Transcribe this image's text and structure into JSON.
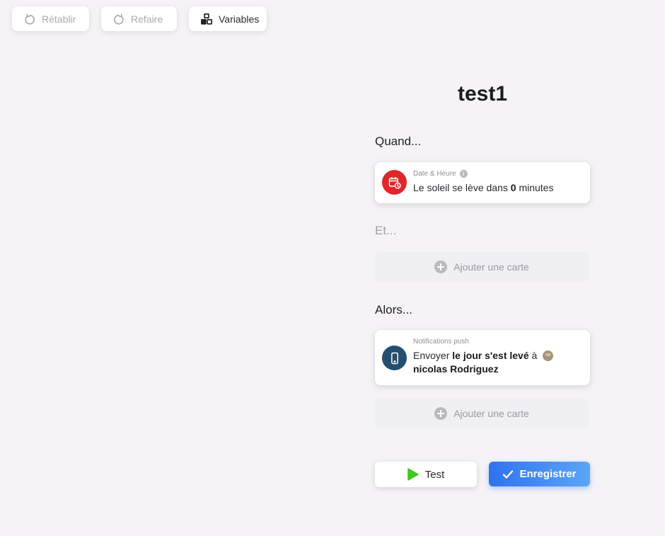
{
  "toolbar": {
    "undo_label": "Rétablir",
    "redo_label": "Refaire",
    "variables_label": "Variables"
  },
  "scenario": {
    "title": "test1"
  },
  "when": {
    "label": "Quand...",
    "card": {
      "category": "Date & Heure",
      "text_before": "Le soleil se lève dans ",
      "value": "0",
      "text_after": " minutes",
      "icon": "calendar-clock-icon",
      "color": "#e2262a"
    }
  },
  "and": {
    "label": "Et...",
    "add_label": "Ajouter une carte"
  },
  "then": {
    "label": "Alors...",
    "card": {
      "category": "Notifications push",
      "text_before": "Envoyer ",
      "message": "le jour s'est levé",
      "text_mid": " à ",
      "recipient": "nicolas Rodriguez",
      "icon": "smartphone-icon",
      "color": "#244f6e"
    },
    "add_label": "Ajouter une carte"
  },
  "actions": {
    "test_label": "Test",
    "save_label": "Enregistrer"
  },
  "colors": {
    "background": "#f5f3f6",
    "primary_gradient_start": "#2f73ee",
    "primary_gradient_end": "#5aa6f7",
    "test_play": "#3fc81e"
  }
}
